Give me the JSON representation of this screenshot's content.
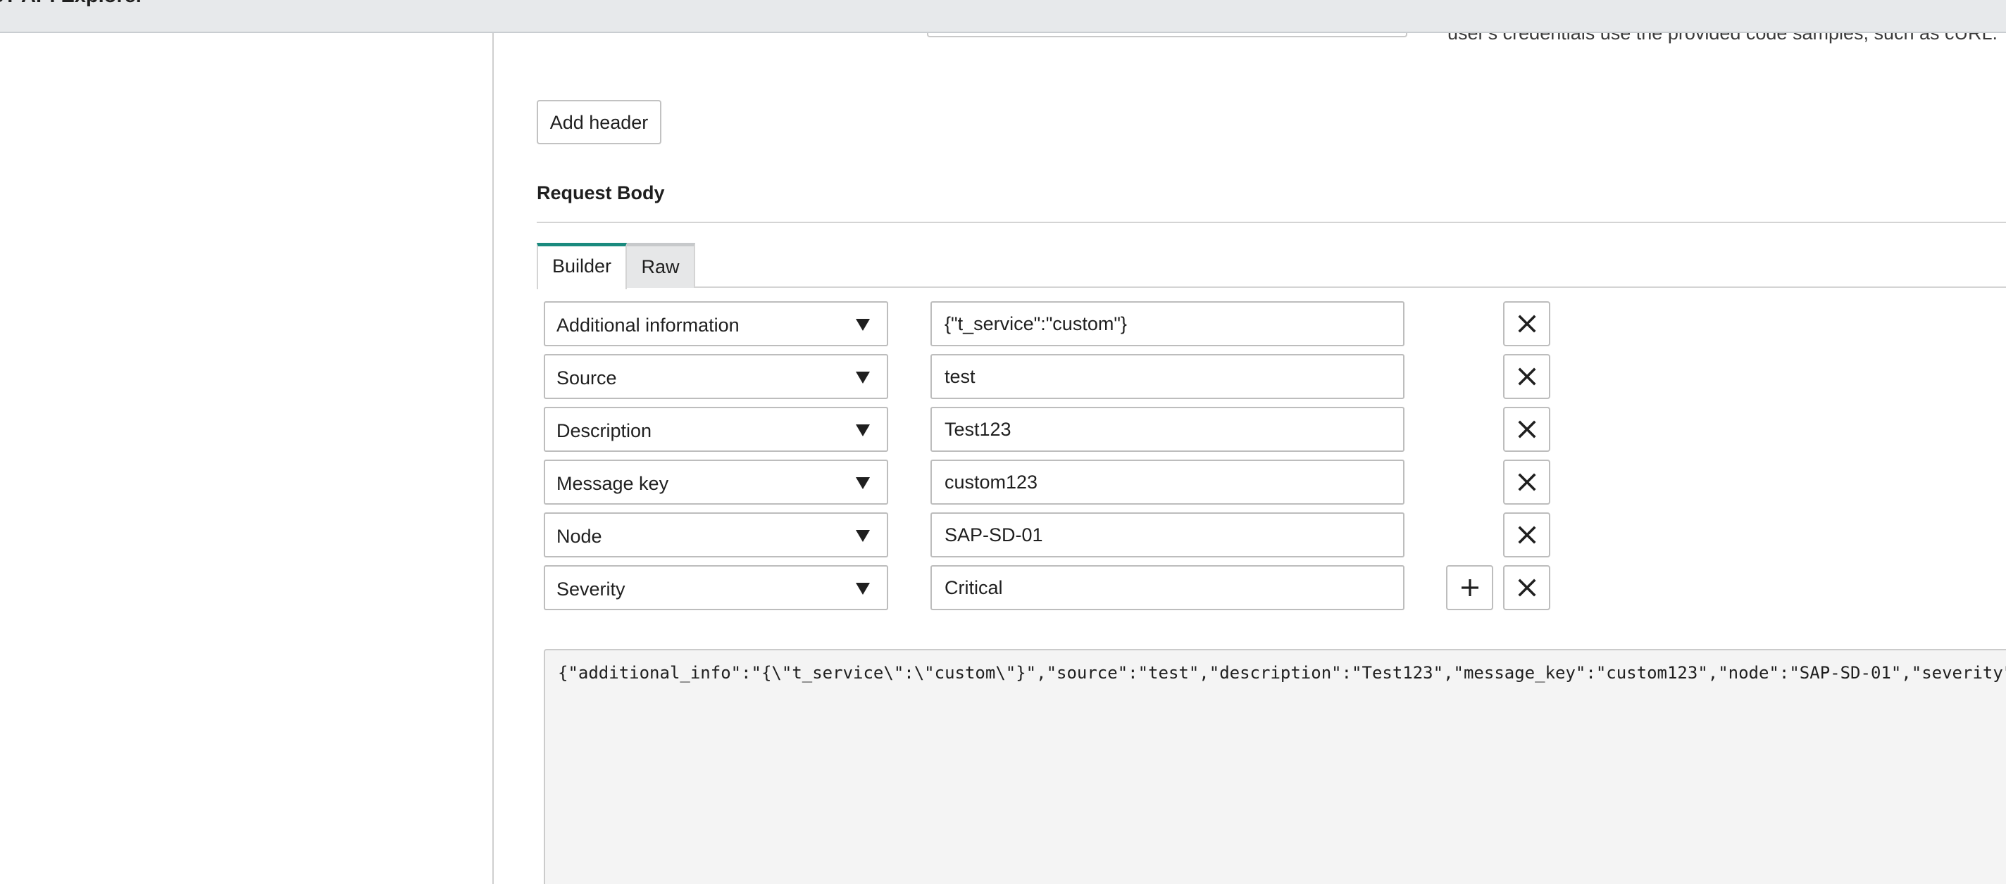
{
  "app": {
    "title": "ST API Explorer"
  },
  "top_fragment": {
    "help_text": "user's credentials use the provided code samples, such as cURL."
  },
  "headers": {
    "add_header_label": "Add header"
  },
  "request_body": {
    "title": "Request Body",
    "tabs": [
      {
        "label": "Builder",
        "active": true
      },
      {
        "label": "Raw",
        "active": false
      }
    ],
    "fields": [
      {
        "key": "Additional information",
        "value": "{\"t_service\":\"custom\"}"
      },
      {
        "key": "Source",
        "value": "test"
      },
      {
        "key": "Description",
        "value": "Test123"
      },
      {
        "key": "Message key",
        "value": "custom123"
      },
      {
        "key": "Node",
        "value": "SAP-SD-01"
      },
      {
        "key": "Severity",
        "value": "Critical"
      }
    ],
    "raw_json": "{\"additional_info\":\"{\\\"t_service\\\":\\\"custom\\\"}\",\"source\":\"test\",\"description\":\"Test123\",\"message_key\":\"custom123\",\"node\":\"SAP-SD-01\",\"severity\":\"Critical\"}"
  },
  "icons": {
    "remove": "close-x-icon",
    "add": "plus-icon",
    "dropdown": "triangle-down-icon"
  },
  "colors": {
    "active_tab_accent": "#1a8a7e",
    "topbar_bg": "#e7e9eb",
    "raw_bg": "#f4f4f4"
  }
}
